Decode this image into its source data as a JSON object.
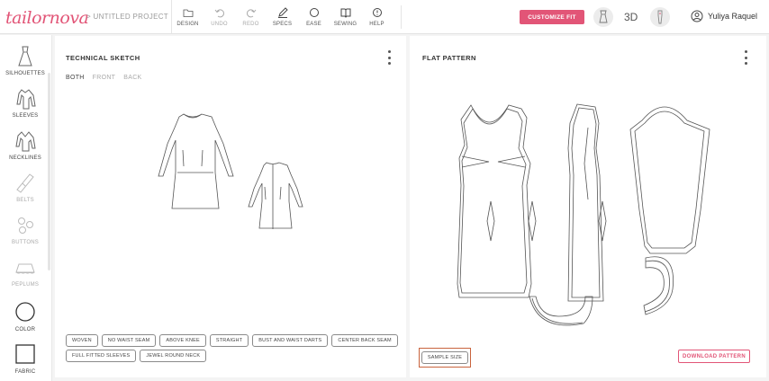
{
  "app": {
    "logo": "tailornova",
    "breadcrumb": "> UNTITLED PROJECT"
  },
  "toolbar": {
    "design": "DESIGN",
    "undo": "UNDO",
    "redo": "REDO",
    "specs": "SPECS",
    "ease": "EASE",
    "sewing": "SEWING",
    "help": "HELP",
    "customize": "CUSTOMIZE FIT",
    "view_3d": "3D",
    "user_name": "Yuliya Raquel"
  },
  "sidebar": {
    "items": [
      {
        "label": "SILHOUETTES",
        "icon": "dress-silhouette-icon"
      },
      {
        "label": "SLEEVES",
        "icon": "sleeves-icon"
      },
      {
        "label": "NECKLINES",
        "icon": "neckline-icon"
      },
      {
        "label": "BELTS",
        "icon": "belt-icon"
      },
      {
        "label": "BUTTONS",
        "icon": "buttons-icon"
      },
      {
        "label": "PEPLUMS",
        "icon": "peplum-icon"
      },
      {
        "label": "COLOR",
        "icon": "color-circle-icon"
      },
      {
        "label": "FABRIC",
        "icon": "fabric-square-icon"
      }
    ]
  },
  "technical_sketch": {
    "title": "TECHNICAL SKETCH",
    "views": [
      "BOTH",
      "FRONT",
      "BACK"
    ],
    "active_view": "BOTH",
    "features": [
      "WOVEN",
      "NO WAIST SEAM",
      "ABOVE KNEE",
      "STRAIGHT",
      "BUST AND WAIST DARTS",
      "CENTER BACK SEAM",
      "FULL FITTED SLEEVES",
      "JEWEL ROUND NECK"
    ]
  },
  "flat_pattern": {
    "title": "FLAT PATTERN",
    "sample_size": "SAMPLE SIZE",
    "download": "DOWNLOAD PATTERN"
  },
  "colors": {
    "brand": "#e25577",
    "highlight": "#c9633d"
  }
}
